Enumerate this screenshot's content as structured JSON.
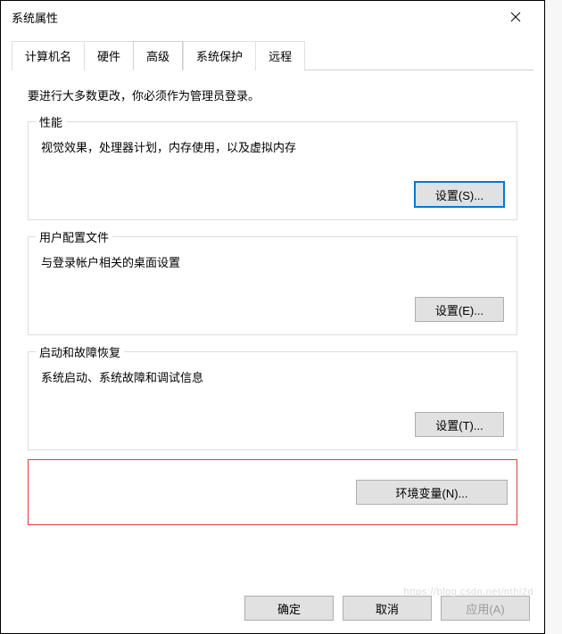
{
  "titlebar": {
    "title": "系统属性"
  },
  "tabs": {
    "items": [
      {
        "label": "计算机名"
      },
      {
        "label": "硬件"
      },
      {
        "label": "高级"
      },
      {
        "label": "系统保护"
      },
      {
        "label": "远程"
      }
    ],
    "active_index": 2
  },
  "panel": {
    "admin_note": "要进行大多数更改，你必须作为管理员登录。",
    "groups": [
      {
        "legend": "性能",
        "desc": "视觉效果，处理器计划，内存使用，以及虚拟内存",
        "button": "设置(S)..."
      },
      {
        "legend": "用户配置文件",
        "desc": "与登录帐户相关的桌面设置",
        "button": "设置(E)..."
      },
      {
        "legend": "启动和故障恢复",
        "desc": "系统启动、系统故障和调试信息",
        "button": "设置(T)..."
      }
    ],
    "env_button": "环境变量(N)..."
  },
  "footer": {
    "ok": "确定",
    "cancel": "取消",
    "apply": "应用(A)"
  },
  "watermark": "https://blog.csdn.net/nthi2d"
}
